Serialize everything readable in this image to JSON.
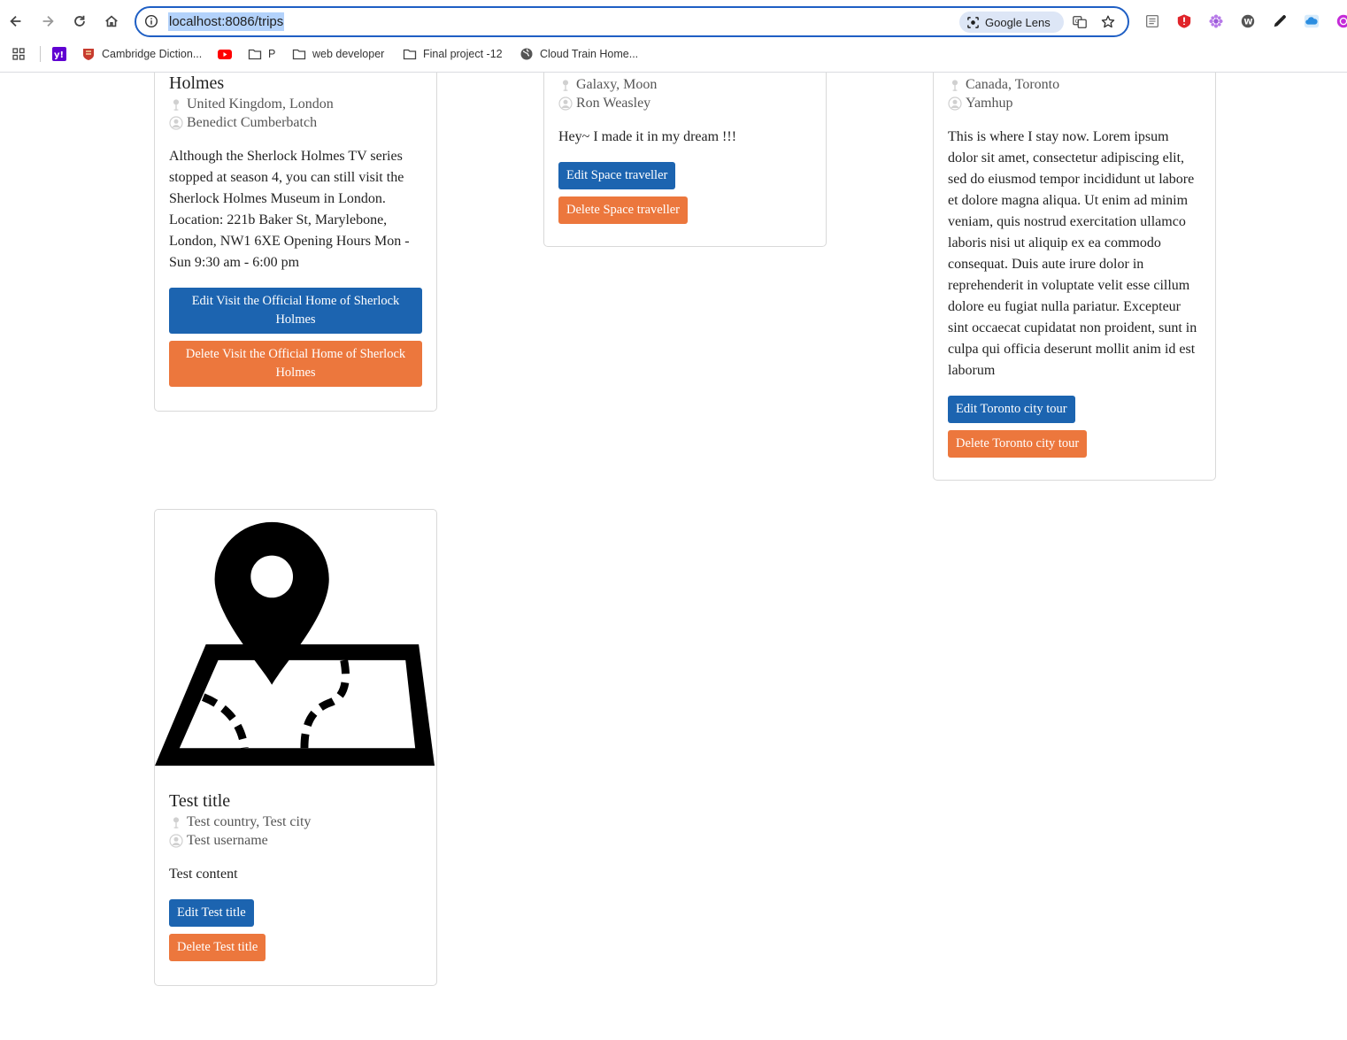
{
  "browser": {
    "url": "localhost:8086/trips",
    "lens_label": "Google Lens",
    "bookmarks": [
      {
        "label": "Cambridge Diction..."
      },
      {
        "label": "P"
      },
      {
        "label": "web developer"
      },
      {
        "label": "Final project -12"
      },
      {
        "label": "Cloud Train Home..."
      }
    ]
  },
  "trips": [
    {
      "title": "Holmes",
      "location": "United Kingdom, London",
      "author": "Benedict Cumberbatch",
      "content": "Although the Sherlock Holmes TV series stopped at season 4, you can still visit the Sherlock Holmes Museum in London. Location: 221b Baker St, Marylebone, London, NW1 6XE Opening Hours Mon - Sun 9:30 am - 6:00 pm",
      "edit_label": "Edit Visit the Official Home of Sherlock Holmes",
      "delete_label": "Delete Visit the Official Home of Sherlock Holmes"
    },
    {
      "location": "Galaxy, Moon",
      "author": "Ron Weasley",
      "content": "Hey~ I made it in my dream !!!",
      "edit_label": "Edit Space traveller",
      "delete_label": "Delete Space traveller"
    },
    {
      "location": "Canada, Toronto",
      "author": "Yamhup",
      "content": "This is where I stay now. Lorem ipsum dolor sit amet, consectetur adipiscing elit, sed do eiusmod tempor incididunt ut labore et dolore magna aliqua. Ut enim ad minim veniam, quis nostrud exercitation ullamco laboris nisi ut aliquip ex ea commodo consequat. Duis aute irure dolor in reprehenderit in voluptate velit esse cillum dolore eu fugiat nulla pariatur. Excepteur sint occaecat cupidatat non proident, sunt in culpa qui officia deserunt mollit anim id est laborum",
      "edit_label": "Edit Toronto city tour",
      "delete_label": "Delete Toronto city tour"
    },
    {
      "title": "Test title",
      "location": "Test country, Test city",
      "author": "Test username",
      "content": "Test content",
      "edit_label": "Edit Test title",
      "delete_label": "Delete Test title",
      "image_icon": "map-location-pin-icon"
    }
  ]
}
